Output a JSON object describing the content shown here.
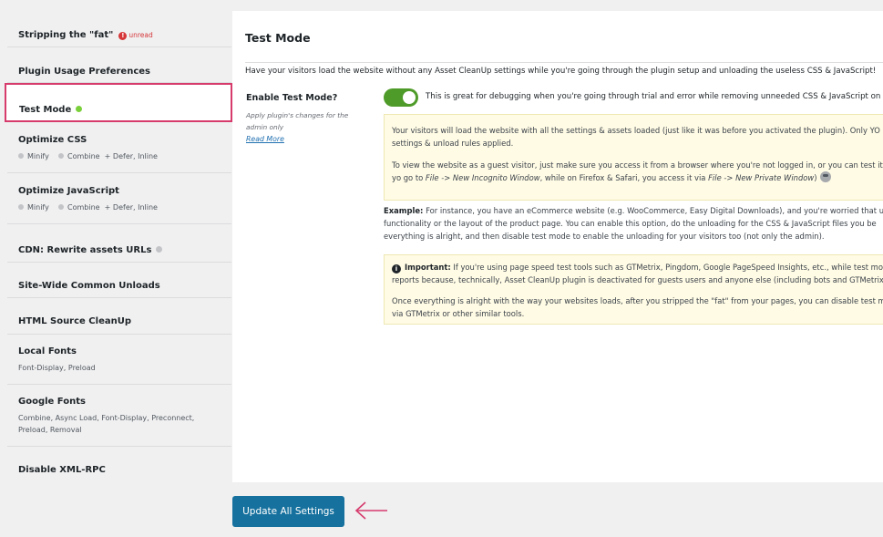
{
  "sidebar": {
    "items": [
      {
        "title": "Stripping the \"fat\"",
        "badge": "!",
        "badge_text": "unread"
      },
      {
        "title": "Plugin Usage Preferences"
      },
      {
        "title": "Test Mode"
      },
      {
        "title": "Optimize CSS",
        "sub": {
          "a": "Minify",
          "b": "Combine",
          "c": "+ Defer, Inline"
        }
      },
      {
        "title": "Optimize JavaScript",
        "sub": {
          "a": "Minify",
          "b": "Combine",
          "c": "+ Defer, Inline"
        }
      },
      {
        "title": "CDN: Rewrite assets URLs"
      },
      {
        "title": "Site-Wide Common Unloads"
      },
      {
        "title": "HTML Source CleanUp"
      },
      {
        "title": "Local Fonts",
        "sub_text": "Font-Display, Preload"
      },
      {
        "title": "Google Fonts",
        "sub_text": "Combine, Async Load, Font-Display, Preconnect, Preload, Removal"
      },
      {
        "title": "Disable XML-RPC"
      }
    ]
  },
  "panel": {
    "title": "Test Mode",
    "description": "Have your visitors load the website without any Asset CleanUp settings while you're going through the plugin setup and unloading the useless CSS & JavaScript!",
    "setting_label": "Enable Test Mode?",
    "setting_note": "Apply plugin's changes for the admin only",
    "read_more": "Read More",
    "toggle_text": "This is great for debugging when you're going through trial and error while removing unneeded CSS & JavaScript on y",
    "notice1": {
      "line1": "Your visitors will load the website with all the settings & assets loaded (just like it was before you activated the plugin). Only YO",
      "line2": "settings & unload rules applied.",
      "line3": "To view the website as a guest visitor, just make sure you access it from a browser where you're not logged in, or you can test it",
      "line4a": "yo go to ",
      "line4b": "File -> New Incognito Window",
      "line4c": ", while on Firefox & Safari, you access it via ",
      "line4d": "File -> New Private Window",
      "line4e": ")"
    },
    "example": {
      "label": "Example:",
      "line1": " For instance, you have an eCommerce website (e.g. WooCommerce, Easy Digital Downloads), and you're worried that u",
      "line2": "functionality or the layout of the product page. You can enable this option, do the unloading for the CSS & JavaScript files you be",
      "line3": "everything is alright, and then disable test mode to enable the unloading for your visitors too (not only the admin)."
    },
    "notice2": {
      "label": "Important:",
      "line1": " If you're using page speed test tools such as GTMetrix, Pingdom, Google PageSpeed Insights, etc., while test mo",
      "line2": "reports because, technically, Asset CleanUp plugin is deactivated for guests users and anyone else (including bots and GTMetrix",
      "line3": "Once everything is alright with the way your websites loads, after you stripped the \"fat\" from your pages, you can disable test m",
      "line4": "via GTMetrix or other similar tools."
    }
  },
  "footer": {
    "update_label": "Update All Settings"
  },
  "colors": {
    "accent": "#16719e",
    "active_border": "#d63b6c",
    "toggle_on": "#4f9b29",
    "notice_bg": "#fffbe5"
  }
}
